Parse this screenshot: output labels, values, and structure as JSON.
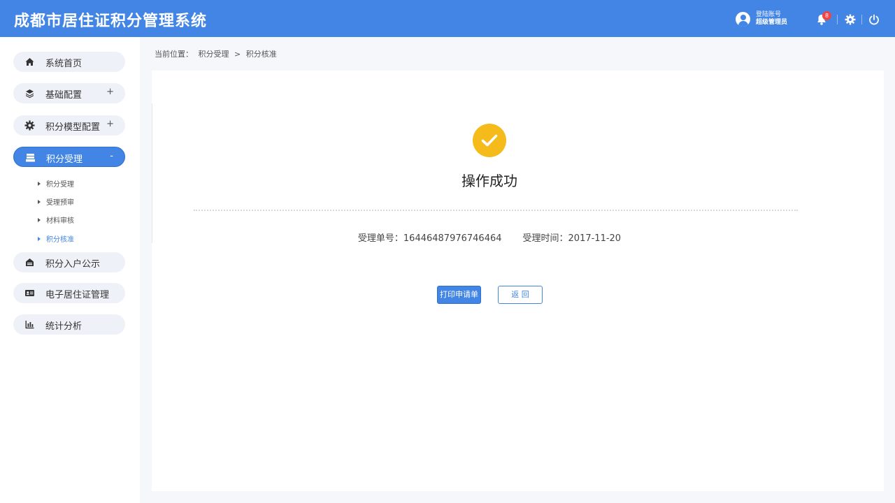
{
  "header": {
    "title": "成都市居住证积分管理系统",
    "user": {
      "login_label": "登陆账号",
      "name": "超级管理员"
    },
    "notifications": {
      "count": "8"
    },
    "icons": [
      "user-avatar-icon",
      "bell-icon",
      "gear-icon",
      "power-icon"
    ],
    "accent_color": "#4285e4"
  },
  "sidebar": {
    "items": [
      {
        "label": "系统首页",
        "icon": "home-icon",
        "toggle": ""
      },
      {
        "label": "基础配置",
        "icon": "layers-icon",
        "toggle": "+"
      },
      {
        "label": "积分模型配置",
        "icon": "gear-icon",
        "toggle": "+"
      },
      {
        "label": "积分受理",
        "icon": "inbox-icon",
        "toggle": "-"
      },
      {
        "label": "积分入户公示",
        "icon": "house-icon",
        "toggle": ""
      },
      {
        "label": "电子居住证管理",
        "icon": "id-card-icon",
        "toggle": ""
      },
      {
        "label": "统计分析",
        "icon": "bar-chart-icon",
        "toggle": ""
      }
    ],
    "subitems": [
      {
        "label": "积分受理"
      },
      {
        "label": "受理预审"
      },
      {
        "label": "材料审核"
      },
      {
        "label": "积分核准",
        "active": true
      }
    ]
  },
  "breadcrumb": {
    "prefix": "当前位置：",
    "path": [
      "积分受理",
      ">",
      "积分核准"
    ]
  },
  "result": {
    "title": "操作成功",
    "icon": "check-circle-icon",
    "icon_color": "#f5bb1a",
    "order_label": "受理单号：",
    "order_value": "16446487976746464",
    "time_label": "受理时间：",
    "time_value": "2017-11-20"
  },
  "buttons": {
    "print": "打印申请单",
    "back": "返 回"
  }
}
